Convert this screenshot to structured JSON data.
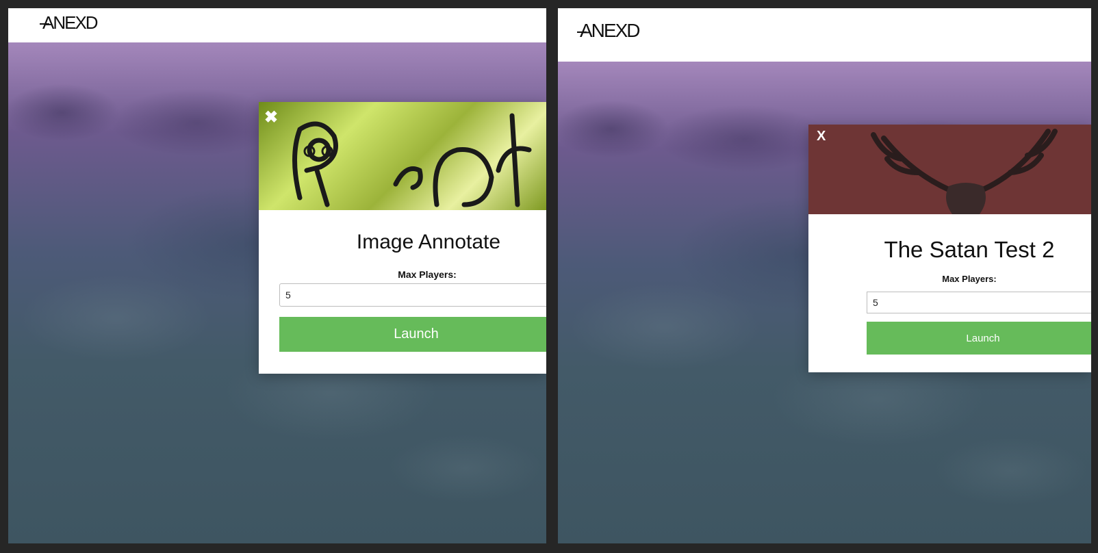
{
  "left": {
    "logo": "ANEXD",
    "modal": {
      "close_label": "✖",
      "title": "Image Annotate",
      "field_label": "Max Players:",
      "field_value": "5",
      "launch_label": "Launch"
    }
  },
  "right": {
    "logo": "ANEXD",
    "modal": {
      "close_label": "X",
      "title": "The Satan Test 2",
      "field_label": "Max Players:",
      "field_value": "5",
      "launch_label": "Launch"
    }
  },
  "colors": {
    "accent_green": "#66bb5a",
    "header_bg": "#ffffff",
    "image_left_tint": "#cfe56b",
    "image_right_tint": "#6e3535"
  }
}
